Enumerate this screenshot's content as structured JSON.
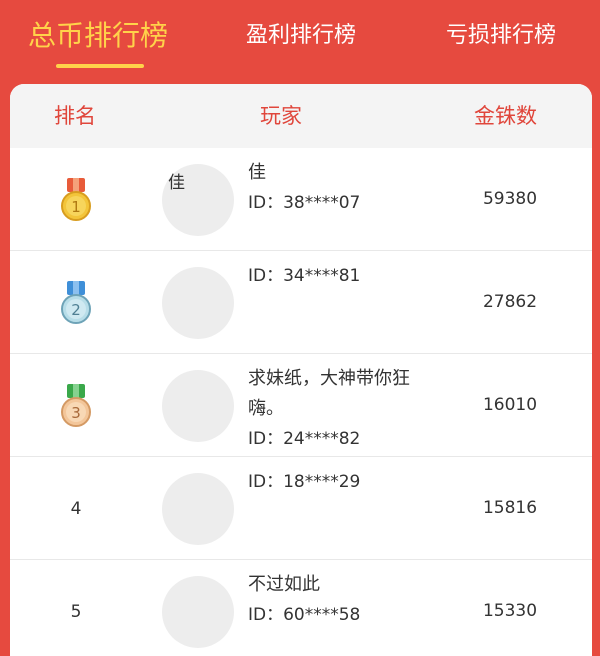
{
  "tabs": [
    {
      "label": "总币排行榜",
      "active": true
    },
    {
      "label": "盈利排行榜",
      "active": false
    },
    {
      "label": "亏损排行榜",
      "active": false
    }
  ],
  "header": {
    "rank": "排名",
    "player": "玩家",
    "coins": "金铢数"
  },
  "colors": {
    "accent": "#e64a3f",
    "tab_active": "#ffd34a",
    "header_text": "#e0463b"
  },
  "rows": [
    {
      "rank": "1",
      "medal": "gold-medal",
      "avatar_text": "佳",
      "name": "佳",
      "id": "ID：38****07",
      "coins": "59380"
    },
    {
      "rank": "2",
      "medal": "silver-medal",
      "avatar_text": "",
      "name": "",
      "id": "ID：34****81",
      "coins": "27862"
    },
    {
      "rank": "3",
      "medal": "bronze-medal",
      "avatar_text": "",
      "name": "求妹纸，大神带你狂嗨。",
      "id": "ID：24****82",
      "coins": "16010"
    },
    {
      "rank": "4",
      "medal": "",
      "avatar_text": "",
      "name": "",
      "id": "ID：18****29",
      "coins": "15816"
    },
    {
      "rank": "5",
      "medal": "",
      "avatar_text": "",
      "name": "不过如此",
      "id": "ID：60****58",
      "coins": "15330"
    }
  ]
}
